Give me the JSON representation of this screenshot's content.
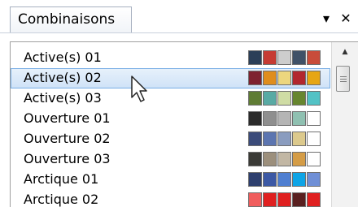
{
  "tab": {
    "label": "Combinaisons"
  },
  "pane_buttons": {
    "menu": "▾",
    "close": "✕"
  },
  "scrollbar": {
    "up_arrow": "▲"
  },
  "list": {
    "items": [
      {
        "label": "Active(s) 01",
        "colors": [
          "#2b3f58",
          "#c63b33",
          "#cdcdcd",
          "#3f5167",
          "#c84c3a"
        ]
      },
      {
        "label": "Active(s) 02",
        "colors": [
          "#7e2230",
          "#df8d1d",
          "#ecd67e",
          "#b2272e",
          "#e6a614"
        ]
      },
      {
        "label": "Active(s) 03",
        "colors": [
          "#5f7c34",
          "#59aaa4",
          "#cfdca4",
          "#67862f",
          "#52c2c5"
        ]
      },
      {
        "label": "Ouverture 01",
        "colors": [
          "#2b2b2b",
          "#8f8f8f",
          "#b5b5b5",
          "#8fc0b1",
          "#ffffff"
        ]
      },
      {
        "label": "Ouverture 02",
        "colors": [
          "#3b4b7a",
          "#5c75b0",
          "#8a9cbf",
          "#dcc98c",
          "#ffffff"
        ]
      },
      {
        "label": "Ouverture 03",
        "colors": [
          "#3a3a36",
          "#9c8f7c",
          "#c2b7a4",
          "#d49c46",
          "#ffffff"
        ]
      },
      {
        "label": "Arctique 01",
        "colors": [
          "#2e3f6e",
          "#3c59a5",
          "#4f7fd1",
          "#0ea4e6",
          "#6f8fd6"
        ]
      },
      {
        "label": "Arctique 02",
        "colors": [
          "#f05d5d",
          "#e02020",
          "#e02020",
          "#5a2020",
          "#e02020"
        ]
      }
    ],
    "selected_index": 1
  }
}
